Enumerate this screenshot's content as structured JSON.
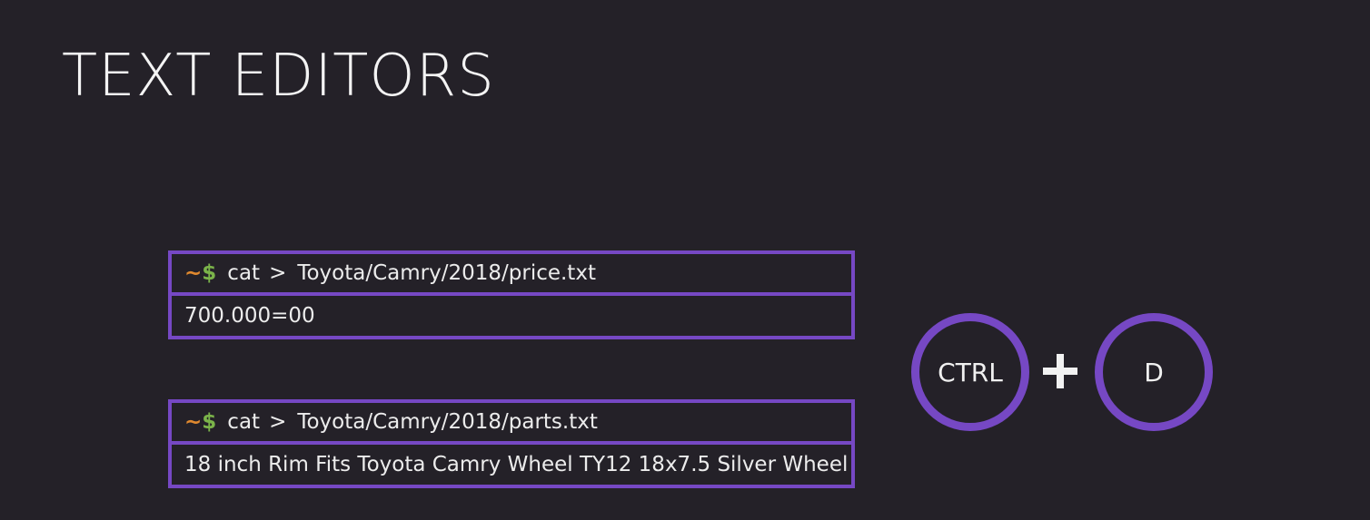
{
  "title": "TEXT EDITORS",
  "terminals": [
    {
      "prompt_tilde": "~",
      "prompt_dollar": "$",
      "command": "cat",
      "operator": ">",
      "path": "Toyota/Camry/2018/price.txt",
      "content": "700.000=00"
    },
    {
      "prompt_tilde": "~",
      "prompt_dollar": "$",
      "command": "cat",
      "operator": ">",
      "path": "Toyota/Camry/2018/parts.txt",
      "content": "18 inch Rim Fits Toyota Camry Wheel TY12 18x7.5 Silver Wheel"
    }
  ],
  "shortcut": {
    "key1": "CTRL",
    "key2": "D"
  },
  "colors": {
    "background": "#242128",
    "accent": "#7648c4",
    "tilde": "#e0892f",
    "dollar": "#7bb44a"
  }
}
